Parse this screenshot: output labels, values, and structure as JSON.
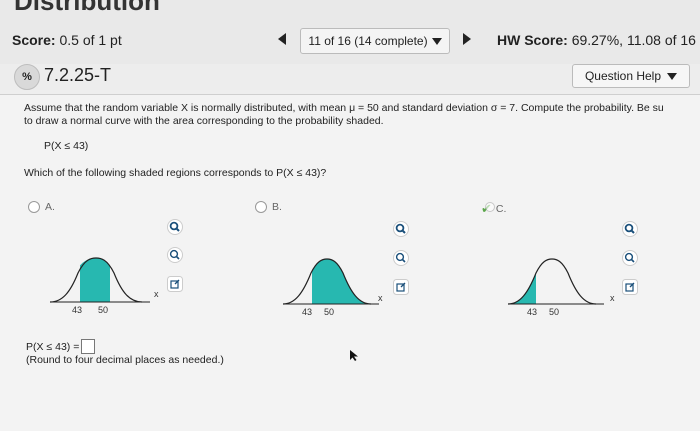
{
  "header": {
    "title_fragment": "Distribution",
    "score_label": "Score:",
    "score_value": "0.5 of 1 pt",
    "question_selector": "11 of 16 (14 complete)",
    "hw_label": "HW Score:",
    "hw_value": "69.27%, 11.08 of 16"
  },
  "question": {
    "number": "7.2.25-T",
    "status_icon": "partial-credit-icon",
    "help_label": "Question Help",
    "paragraph_line1": "Assume that the random variable X is normally distributed, with mean μ = 50 and standard deviation σ = 7. Compute the probability. Be su",
    "paragraph_line2": "to draw a normal curve with the area corresponding to the probability shaded.",
    "probability": "P(X ≤ 43)",
    "prompt": "Which of the following shaded regions corresponds to P(X ≤ 43)?"
  },
  "options": [
    {
      "label": "A.",
      "tick_left": "43",
      "tick_right": "50",
      "axis": "x",
      "selected": false
    },
    {
      "label": "B.",
      "tick_left": "43",
      "tick_right": "50",
      "axis": "x",
      "selected": false
    },
    {
      "label": "C.",
      "tick_left": "43",
      "tick_right": "50",
      "axis": "x",
      "selected": true
    }
  ],
  "answer": {
    "label": "P(X ≤ 43) =",
    "value": "",
    "note": "(Round to four decimal places as needed.)"
  },
  "colors": {
    "shade": "#27b8b0",
    "check": "#5aa64a",
    "accent_icon": "#1a4f7a"
  }
}
